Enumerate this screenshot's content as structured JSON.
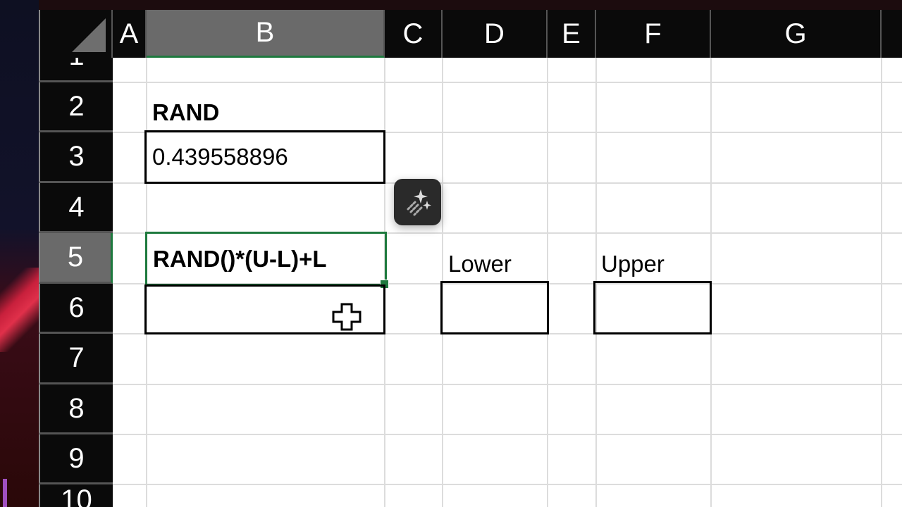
{
  "columns": [
    "A",
    "B",
    "C",
    "D",
    "E",
    "F",
    "G"
  ],
  "rows": [
    "1",
    "2",
    "3",
    "4",
    "5",
    "6",
    "7",
    "8",
    "9",
    "10"
  ],
  "selected_cell": "B5",
  "cells": {
    "B2": "RAND",
    "B3": "0.439558896",
    "B5": "RAND()*(U-L)+L",
    "D5": "Lower",
    "F5": "Upper",
    "B6": "",
    "D6": "",
    "F6": ""
  },
  "colors": {
    "selection": "#1e7a3e",
    "header_bg": "#0a0a0a",
    "selected_header_bg": "#6a6a6a"
  },
  "icons": {
    "copilot": "sparkle-icon",
    "cursor": "cross-cursor-icon"
  }
}
